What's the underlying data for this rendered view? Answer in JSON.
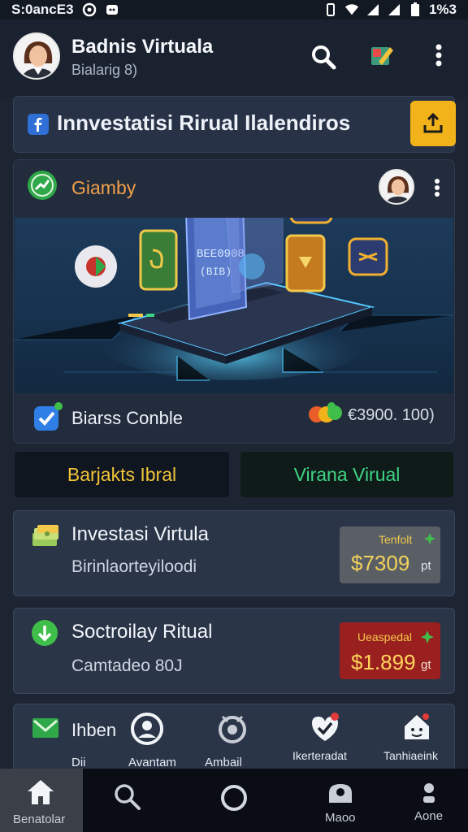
{
  "status_bar": {
    "time_left": "S:0ancE3",
    "time_right": "1%3"
  },
  "header": {
    "title": "Badnis Virtuala",
    "subtitle": "Bialarig 8)"
  },
  "banner": {
    "text": "Innvestatisi Rirual Ilalendiros"
  },
  "hero": {
    "label": "Giamby",
    "screen_text_1": "BEE0908",
    "screen_text_2": "(BIB)",
    "footer_label": "Biarss Conble",
    "footer_amount": "€3900. 100)"
  },
  "tabs": {
    "left": "Barjakts Ibral",
    "right": "Virana Virual"
  },
  "cards": [
    {
      "title": "Investasi Virtula",
      "subtitle": "Birinlaorteyiloodi",
      "price_label": "Tenfolt",
      "price": "$7309",
      "price_suffix": "pt",
      "price_bg": "#5a5f66",
      "price_label_color": "#f0c84a",
      "price_color": "#f2d25a"
    },
    {
      "title": "Soctroilay Ritual",
      "subtitle": "Camtadeo 80J",
      "price_label": "Ueaspedal",
      "price": "$1.899",
      "price_suffix": "gt",
      "price_bg": "#9a2020",
      "price_label_color": "#f4c84a",
      "price_color": "#ffd45a"
    }
  ],
  "shortcuts": [
    {
      "label": "Ihben",
      "sublabel": "Dii"
    },
    {
      "label": "Avantam"
    },
    {
      "label": "Ambail"
    },
    {
      "label": "Ikerteradat"
    },
    {
      "label": "Tanhiaeink"
    }
  ],
  "bottom_nav": [
    {
      "label": "Benatolar"
    },
    {
      "label": ""
    },
    {
      "label": ""
    },
    {
      "label": "Maoo"
    },
    {
      "label": "Aone"
    }
  ],
  "colors": {
    "accent_yellow": "#f2b31a",
    "accent_green": "#3fd485",
    "bg": "#1d2533"
  }
}
